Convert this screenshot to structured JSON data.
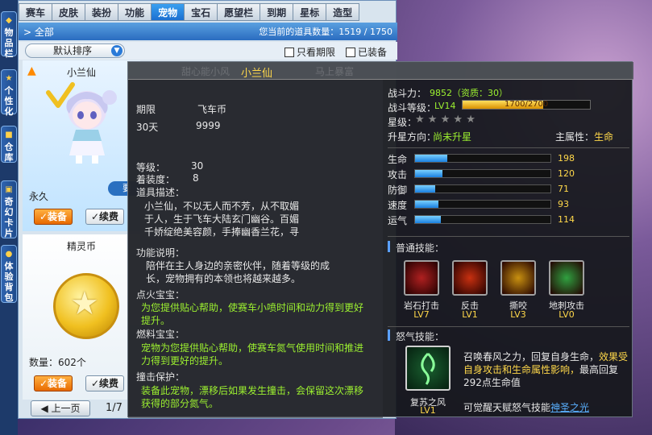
{
  "sidebar": {
    "tabs": [
      "物品栏",
      "个性化",
      "仓库",
      "奇幻卡片",
      "体验背包"
    ]
  },
  "tabs": [
    "赛车",
    "皮肤",
    "装扮",
    "功能",
    "宠物",
    "宝石",
    "愿望栏",
    "到期",
    "星标",
    "造型"
  ],
  "active_tab": "宠物",
  "filter": {
    "all_label": "全部",
    "count_text": "您当前的道具数量：1519 / 1750"
  },
  "sort": {
    "label": "默认排序",
    "chk_expire": "只看期限",
    "chk_equipped": "已装备"
  },
  "card1": {
    "name": "小兰仙",
    "perm": "永久",
    "equip": "装备",
    "renew": "续费",
    "badge": "要"
  },
  "card2": {
    "name": "精灵币",
    "qty": "数量：602个",
    "equip": "装备",
    "renew": "续费"
  },
  "pager": {
    "prev": "上一页",
    "page": "1/7"
  },
  "tooltip": {
    "title": "小兰仙",
    "ghost_left": "甜心能小风",
    "ghost_right": "马上暴富",
    "period_label": "期限",
    "price_label": "飞车币",
    "period_value": "30天",
    "price_value": "9999",
    "level_label": "等级：",
    "level_value": "30",
    "equip_label": "着装度：",
    "equip_value": "8",
    "desc_label": "道具描述：",
    "desc": "小兰仙，不以无人而不芳，从不取媚于人，生于飞车大陆玄门幽谷。百媚千娇绽绝美容颜，手捧幽香兰花，寻觅一身正气的君子为主。",
    "func_label": "功能说明：",
    "func": "陪伴在主人身边的亲密伙伴，随着等级的成长，宠物拥有的本领也将越来越多。",
    "fire_label": "点火宝宝：",
    "fire": "为您提供贴心帮助，使赛车小喷时间和动力得到更好提升。",
    "fuel_label": "燃料宝宝：",
    "fuel": "宠物为您提供贴心帮助，使赛车氮气使用时间和推进力得到更好的提升。",
    "crash_label": "撞击保护：",
    "crash": "装备此宠物，漂移后如果发生撞击，会保留这次漂移获得的部分氮气。",
    "power_label": "战斗力：",
    "power_value": "9852（资质：30）",
    "battle_level_label": "战斗等级：",
    "battle_level": "LV14",
    "exp_text": "1700/2700",
    "exp_ratio": 0.63,
    "star_label": "星级：",
    "stars": 5,
    "upgrade_label": "升星方向：",
    "upgrade_value": "尚未升星",
    "attr_label": "主属性：",
    "attr_value": "生命",
    "stats": [
      {
        "label": "生命",
        "value": "198",
        "ratio": 0.24
      },
      {
        "label": "攻击",
        "value": "120",
        "ratio": 0.2
      },
      {
        "label": "防御",
        "value": "71",
        "ratio": 0.15
      },
      {
        "label": "速度",
        "value": "93",
        "ratio": 0.17
      },
      {
        "label": "运气",
        "value": "114",
        "ratio": 0.19
      }
    ],
    "skills_label": "普通技能：",
    "skills": [
      {
        "name": "岩石打击",
        "lv": "LV7",
        "color": "#b02020"
      },
      {
        "name": "反击",
        "lv": "LV1",
        "color": "#c83010"
      },
      {
        "name": "撕咬",
        "lv": "LV3",
        "color": "#c89010"
      },
      {
        "name": "地刺攻击",
        "lv": "LV0",
        "color": "#30a040"
      }
    ],
    "rage_label": "怒气技能：",
    "rage_skill_name": "复苏之风",
    "rage_skill_lv": "LV1",
    "rage_desc1": "召唤春风之力，回复自身生命，",
    "rage_desc2": "效果受自身攻击和生命属性影响，",
    "rage_desc3": "最高回复292点生命值",
    "awaken_text": "可觉醒天赋怒气技能",
    "awaken_link": "神圣之光"
  }
}
